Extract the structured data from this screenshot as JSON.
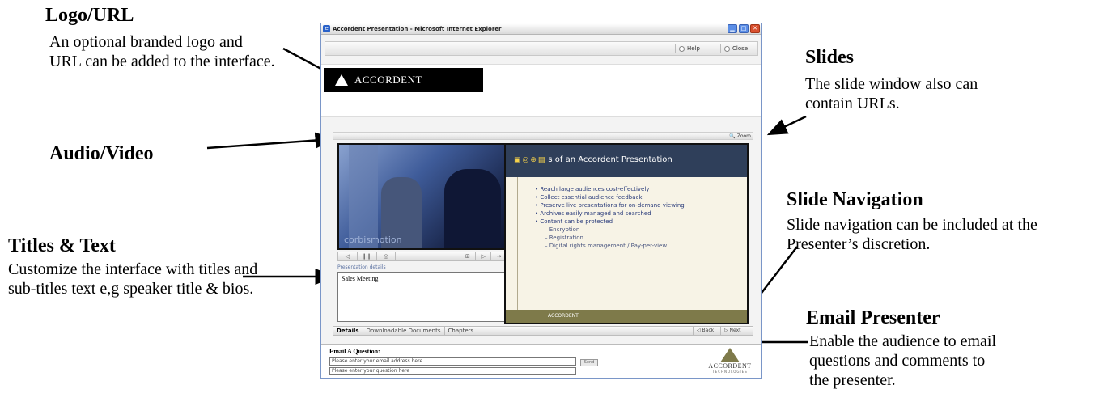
{
  "annotations": {
    "logo": {
      "title": "Logo/URL",
      "desc": "An optional branded logo and URL can be added to the interface."
    },
    "audio_video": {
      "title": "Audio/Video"
    },
    "titles_text": {
      "title": "Titles & Text",
      "desc": "Customize the interface with titles and sub-titles text e,g speaker title & bios."
    },
    "slides": {
      "title": "Slides",
      "desc": "The slide window also can contain URLs."
    },
    "slide_nav": {
      "title": "Slide Navigation",
      "desc": "Slide navigation can be included at the Presenter’s discretion."
    },
    "email": {
      "title": "Email Presenter",
      "desc": "Enable the audience to email questions and comments to the presenter."
    }
  },
  "window": {
    "title": "Accordent Presentation - Microsoft Internet Explorer",
    "icon": "ie-icon",
    "controls": [
      "minimize-icon",
      "maximize-icon",
      "close-icon"
    ],
    "min_glyph": "▁",
    "max_glyph": "□",
    "close_glyph": "✕"
  },
  "toolbar": {
    "help_label": "Help",
    "close_label": "Close"
  },
  "logo": {
    "text": "ACCORDENT"
  },
  "zoom": {
    "label": "Zoom",
    "glyph": "🔍"
  },
  "video": {
    "caption": "corbismotion"
  },
  "player_controls": [
    "◁",
    "❙❙",
    "◎",
    "⊞",
    "▷",
    "→"
  ],
  "details": {
    "label": "Presentation details",
    "text": "Sales Meeting"
  },
  "tabs": {
    "details": "Details",
    "downloads": "Downloadable Documents",
    "chapters": "Chapters"
  },
  "nav": {
    "back": "Back",
    "next": "Next"
  },
  "slide": {
    "icons": "▣◎⊕▤",
    "title": "s of an Accordent Presentation",
    "bullets": [
      "Reach large audiences cost-effectively",
      "Collect essential audience feedback",
      "Preserve live presentations for on-demand viewing",
      "Archives easily managed and searched",
      "Content can be protected"
    ],
    "sub_bullets": [
      "Encryption",
      "Registration",
      "Digital rights management / Pay-per-view"
    ],
    "footer": "ACCORDENT"
  },
  "email": {
    "label": "Email A Question:",
    "email_placeholder": "Please enter your email address here",
    "question_placeholder": "Please enter your question here",
    "send_label": "Send"
  },
  "brand_logo": {
    "text": "ACCORDENT",
    "sub": "TECHNOLOGIES"
  },
  "colors": {
    "title_bar": "#7a96c8",
    "slide_header": "#2f3f5a",
    "slide_footer": "#7e7a4a",
    "logo_bg": "#000000"
  }
}
